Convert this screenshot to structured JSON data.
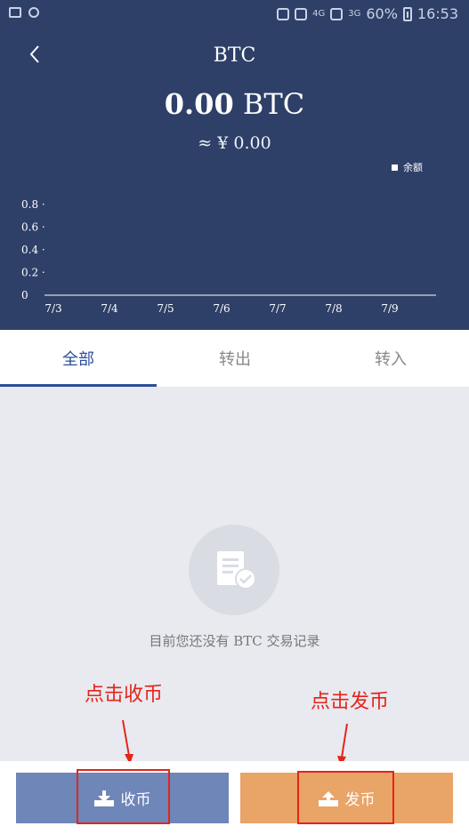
{
  "status_bar": {
    "network": "4G",
    "network2": "3G",
    "battery": "60%",
    "time": "16:53"
  },
  "header": {
    "title": "BTC"
  },
  "balance": {
    "amount": "0.00",
    "unit": "BTC",
    "fiat": "≈ ¥ 0.00"
  },
  "chart_data": {
    "type": "line",
    "title": "",
    "xlabel": "",
    "ylabel": "",
    "categories": [
      "7/3",
      "7/4",
      "7/5",
      "7/6",
      "7/7",
      "7/8",
      "7/9"
    ],
    "y_ticks": [
      "0",
      "0.2",
      "0.4",
      "0.6",
      "0.8"
    ],
    "series": [
      {
        "name": "余额",
        "values": [
          0,
          0,
          0,
          0,
          0,
          0,
          0
        ]
      }
    ],
    "ylim": [
      0,
      0.8
    ],
    "grid": false,
    "legend": "top-right"
  },
  "tabs": [
    {
      "label": "全部",
      "active": true
    },
    {
      "label": "转出",
      "active": false
    },
    {
      "label": "转入",
      "active": false
    }
  ],
  "empty_state": {
    "message": "目前您还没有 BTC 交易记录",
    "icon": "document-check-icon"
  },
  "annotations": {
    "receive_note": "点击收币",
    "send_note": "点击发币",
    "color": "#e5241a"
  },
  "actions": {
    "receive_label": "收币",
    "send_label": "发币"
  },
  "colors": {
    "header_bg": "#2e4068",
    "accent": "#2b4e9a",
    "receive_btn": "#6e86b8",
    "send_btn": "#e9a468"
  }
}
